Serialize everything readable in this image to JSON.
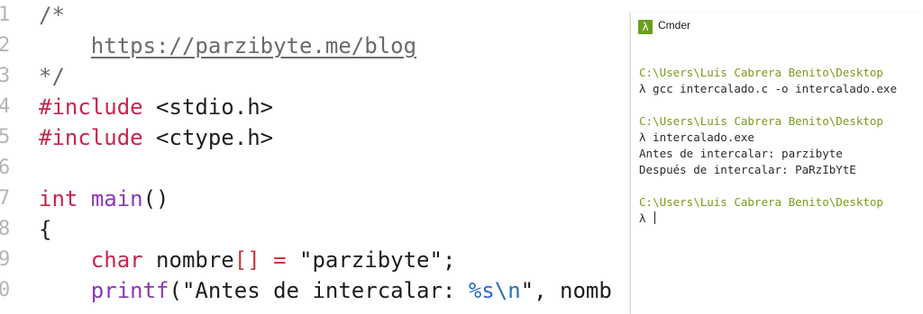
{
  "editor": {
    "lines": [
      {
        "num": "1",
        "parts": [
          {
            "t": "/*",
            "c": "comment"
          }
        ]
      },
      {
        "num": "2",
        "parts": [
          {
            "t": "    ",
            "c": "plain"
          },
          {
            "t": "https://parzibyte.me/blog",
            "c": "link"
          }
        ]
      },
      {
        "num": "3",
        "parts": [
          {
            "t": "*/",
            "c": "comment"
          }
        ]
      },
      {
        "num": "4",
        "parts": [
          {
            "t": "#include",
            "c": "kw"
          },
          {
            "t": " <stdio.h>",
            "c": "plain"
          }
        ]
      },
      {
        "num": "5",
        "parts": [
          {
            "t": "#include",
            "c": "kw"
          },
          {
            "t": " <ctype.h>",
            "c": "plain"
          }
        ]
      },
      {
        "num": "6",
        "parts": []
      },
      {
        "num": "7",
        "parts": [
          {
            "t": "int",
            "c": "kw"
          },
          {
            "t": " ",
            "c": "plain"
          },
          {
            "t": "main",
            "c": "fn"
          },
          {
            "t": "()",
            "c": "plain"
          }
        ]
      },
      {
        "num": "8",
        "parts": [
          {
            "t": "{",
            "c": "plain"
          }
        ]
      },
      {
        "num": "9",
        "parts": [
          {
            "t": "    ",
            "c": "plain"
          },
          {
            "t": "char",
            "c": "kw"
          },
          {
            "t": " nombre",
            "c": "plain"
          },
          {
            "t": "[]",
            "c": "red"
          },
          {
            "t": " ",
            "c": "plain"
          },
          {
            "t": "=",
            "c": "red"
          },
          {
            "t": " \"parzibyte\";",
            "c": "str"
          }
        ]
      },
      {
        "num": "0",
        "parts": [
          {
            "t": "    ",
            "c": "plain"
          },
          {
            "t": "printf",
            "c": "fn"
          },
          {
            "t": "(\"Antes de intercalar: ",
            "c": "str"
          },
          {
            "t": "%s\\n",
            "c": "esc"
          },
          {
            "t": "\", nomb",
            "c": "str"
          }
        ]
      }
    ]
  },
  "cmder": {
    "title": "Cmder",
    "icon": "lambda-icon",
    "lines": [
      {
        "t": "C:\\Users\\Luis Cabrera Benito\\Desktop",
        "c": "prompt"
      },
      {
        "t": "λ gcc intercalado.c -o intercalado.exe",
        "c": "out"
      },
      {
        "t": "",
        "c": "out"
      },
      {
        "t": "C:\\Users\\Luis Cabrera Benito\\Desktop",
        "c": "prompt"
      },
      {
        "t": "λ intercalado.exe",
        "c": "out"
      },
      {
        "t": "Antes de intercalar: parzibyte",
        "c": "out"
      },
      {
        "t": "Después de intercalar: PaRzIbYtE",
        "c": "out"
      },
      {
        "t": "",
        "c": "out"
      },
      {
        "t": "C:\\Users\\Luis Cabrera Benito\\Desktop",
        "c": "prompt"
      },
      {
        "t": "λ ",
        "c": "out",
        "cursor": true
      }
    ]
  }
}
